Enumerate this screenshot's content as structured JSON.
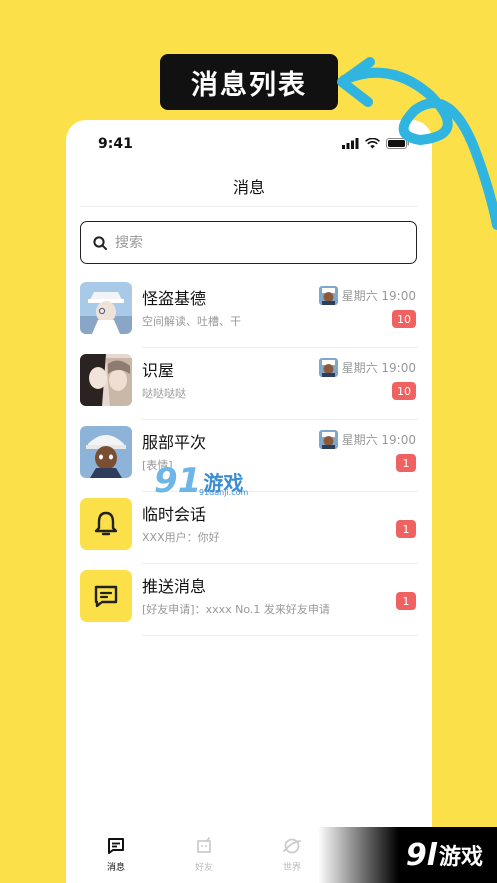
{
  "promo": {
    "title": "消息列表"
  },
  "status_bar": {
    "time": "9:41"
  },
  "nav": {
    "title": "消息"
  },
  "search": {
    "placeholder": "搜索"
  },
  "conversations": [
    {
      "name": "怪盗基德",
      "preview": "空间解读、吐槽、干",
      "time": "星期六 19:00",
      "unread": "10"
    },
    {
      "name": "识屋",
      "preview": "哒哒哒哒",
      "time": "星期六 19:00",
      "unread": "10"
    },
    {
      "name": "服部平次",
      "preview": "[表情]",
      "time": "星期六 19:00",
      "unread": "1"
    },
    {
      "name": "临时会话",
      "preview": "XXX用户：你好",
      "unread": "1",
      "icon": "bell-icon"
    },
    {
      "name": "推送消息",
      "preview": "[好友申请]：xxxx No.1 发来好友申请",
      "unread": "1",
      "icon": "message-icon"
    }
  ],
  "tabs": [
    {
      "label": "消息",
      "icon": "chat-icon",
      "active": true
    },
    {
      "label": "好友",
      "icon": "friends-icon",
      "active": false
    },
    {
      "label": "世界",
      "icon": "planet-icon",
      "active": false
    }
  ],
  "watermark": {
    "brand_number": "91",
    "brand_text": "游戏",
    "url": "91danji.com"
  },
  "corner_brand": {
    "number": "9l",
    "text": "游戏"
  },
  "colors": {
    "background": "#FCE04A",
    "badge": "#F06262",
    "accent_curve": "#2FB5E0"
  }
}
